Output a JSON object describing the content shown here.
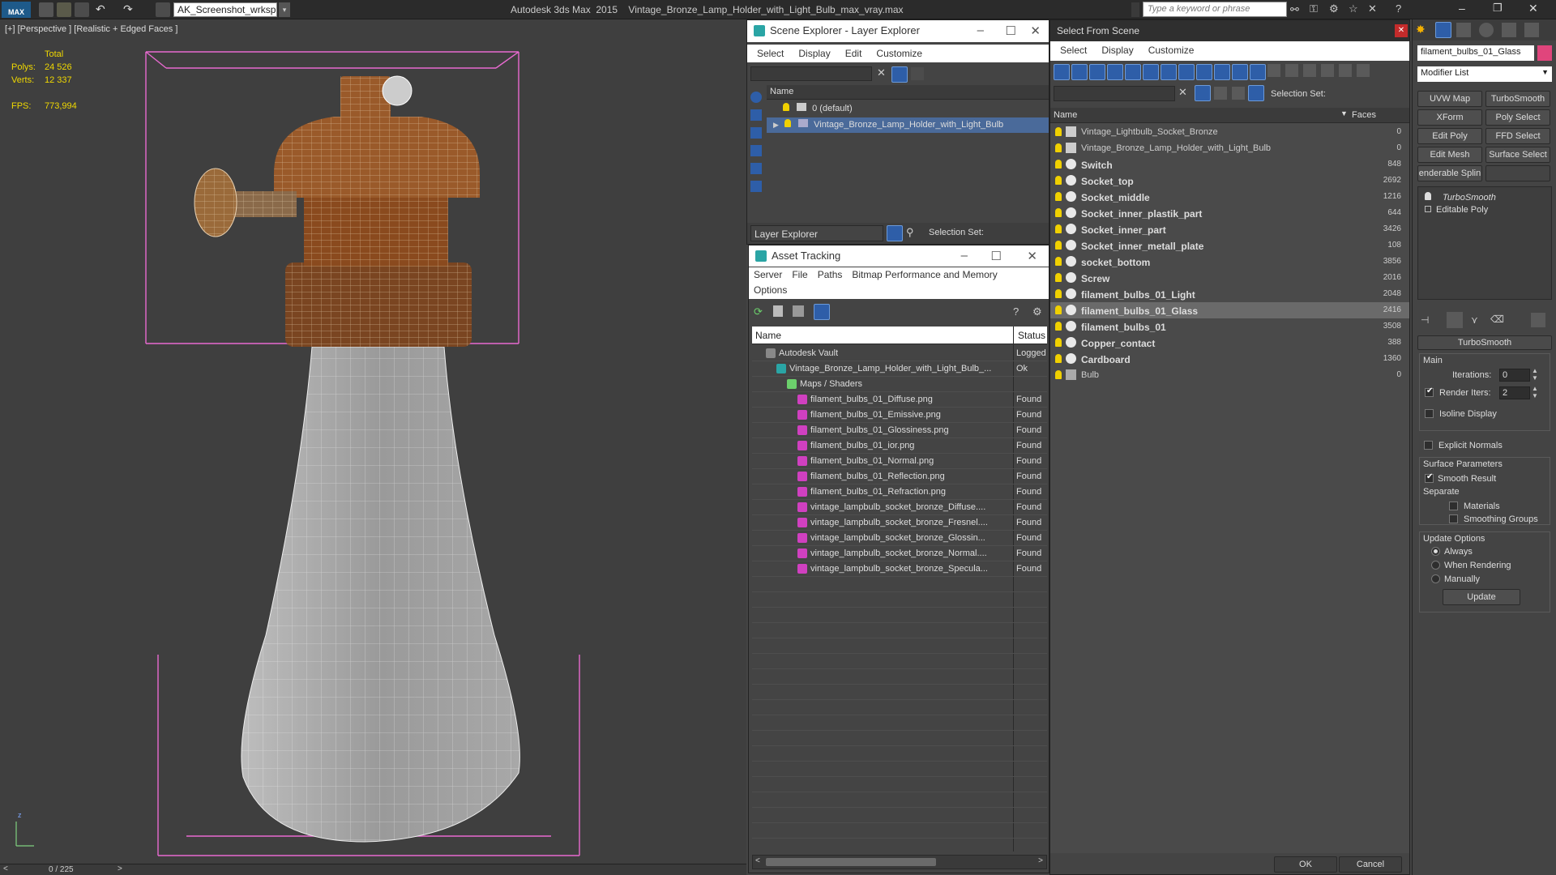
{
  "app": {
    "title": "Autodesk 3ds Max  2015    Vintage_Bronze_Lamp_Holder_with_Light_Bulb_max_vray.max",
    "workspace": "AK_Screenshot_wrksp",
    "search_placeholder": "Type a keyword or phrase",
    "logo": "MAX"
  },
  "viewport": {
    "label": "[+] [Perspective ] [Realistic + Edged Faces ]",
    "stats": {
      "total_label": "Total",
      "polys_label": "Polys:",
      "polys": "24 526",
      "verts_label": "Verts:",
      "verts": "12 337",
      "fps_label": "FPS:",
      "fps": "773,994"
    },
    "timeline": "0 / 225"
  },
  "scene_explorer": {
    "title": "Scene Explorer - Layer Explorer",
    "menu": [
      "Select",
      "Display",
      "Edit",
      "Customize"
    ],
    "col_name": "Name",
    "layers": [
      {
        "name": "0 (default)",
        "selected": false
      },
      {
        "name": "Vintage_Bronze_Lamp_Holder_with_Light_Bulb",
        "selected": true
      }
    ],
    "footer_combo": "Layer Explorer",
    "selection_set": "Selection Set:"
  },
  "asset_tracking": {
    "title": "Asset Tracking",
    "menu1": [
      "Server",
      "File",
      "Paths",
      "Bitmap Performance and Memory"
    ],
    "menu2": [
      "Options"
    ],
    "col_name": "Name",
    "col_status": "Status",
    "rows": [
      {
        "name": "Autodesk Vault",
        "status": "Logged",
        "indent": 1,
        "icon": "vault-icon"
      },
      {
        "name": "Vintage_Bronze_Lamp_Holder_with_Light_Bulb_...",
        "status": "Ok",
        "indent": 2,
        "icon": "max-file-icon"
      },
      {
        "name": "Maps / Shaders",
        "status": "",
        "indent": 3,
        "icon": "maps-icon"
      },
      {
        "name": "filament_bulbs_01_Diffuse.png",
        "status": "Found",
        "indent": 4,
        "icon": "png-icon"
      },
      {
        "name": "filament_bulbs_01_Emissive.png",
        "status": "Found",
        "indent": 4,
        "icon": "png-icon"
      },
      {
        "name": "filament_bulbs_01_Glossiness.png",
        "status": "Found",
        "indent": 4,
        "icon": "png-icon"
      },
      {
        "name": "filament_bulbs_01_ior.png",
        "status": "Found",
        "indent": 4,
        "icon": "png-icon"
      },
      {
        "name": "filament_bulbs_01_Normal.png",
        "status": "Found",
        "indent": 4,
        "icon": "png-icon"
      },
      {
        "name": "filament_bulbs_01_Reflection.png",
        "status": "Found",
        "indent": 4,
        "icon": "png-icon"
      },
      {
        "name": "filament_bulbs_01_Refraction.png",
        "status": "Found",
        "indent": 4,
        "icon": "png-icon"
      },
      {
        "name": "vintage_lampbulb_socket_bronze_Diffuse....",
        "status": "Found",
        "indent": 4,
        "icon": "png-icon"
      },
      {
        "name": "vintage_lampbulb_socket_bronze_Fresnel....",
        "status": "Found",
        "indent": 4,
        "icon": "png-icon"
      },
      {
        "name": "vintage_lampbulb_socket_bronze_Glossin...",
        "status": "Found",
        "indent": 4,
        "icon": "png-icon"
      },
      {
        "name": "vintage_lampbulb_socket_bronze_Normal....",
        "status": "Found",
        "indent": 4,
        "icon": "png-icon"
      },
      {
        "name": "vintage_lampbulb_socket_bronze_Specula...",
        "status": "Found",
        "indent": 4,
        "icon": "png-icon"
      }
    ]
  },
  "select_from_scene": {
    "title": "Select From Scene",
    "menu": [
      "Select",
      "Display",
      "Customize"
    ],
    "selection_set": "Selection Set:",
    "col_name": "Name",
    "col_faces": "Faces",
    "objects": [
      {
        "name": "Vintage_Lightbulb_Socket_Bronze",
        "faces": "0",
        "bold": false,
        "selected": false,
        "kind": "group"
      },
      {
        "name": "Vintage_Bronze_Lamp_Holder_with_Light_Bulb",
        "faces": "0",
        "bold": false,
        "selected": false,
        "kind": "group"
      },
      {
        "name": "Switch",
        "faces": "848",
        "bold": true,
        "selected": false,
        "kind": "mesh"
      },
      {
        "name": "Socket_top",
        "faces": "2692",
        "bold": true,
        "selected": false,
        "kind": "mesh"
      },
      {
        "name": "Socket_middle",
        "faces": "1216",
        "bold": true,
        "selected": false,
        "kind": "mesh"
      },
      {
        "name": "Socket_inner_plastik_part",
        "faces": "644",
        "bold": true,
        "selected": false,
        "kind": "mesh"
      },
      {
        "name": "Socket_inner_part",
        "faces": "3426",
        "bold": true,
        "selected": false,
        "kind": "mesh"
      },
      {
        "name": "Socket_inner_metall_plate",
        "faces": "108",
        "bold": true,
        "selected": false,
        "kind": "mesh"
      },
      {
        "name": "socket_bottom",
        "faces": "3856",
        "bold": true,
        "selected": false,
        "kind": "mesh"
      },
      {
        "name": "Screw",
        "faces": "2016",
        "bold": true,
        "selected": false,
        "kind": "mesh"
      },
      {
        "name": "filament_bulbs_01_Light",
        "faces": "2048",
        "bold": true,
        "selected": false,
        "kind": "mesh"
      },
      {
        "name": "filament_bulbs_01_Glass",
        "faces": "2416",
        "bold": true,
        "selected": true,
        "kind": "mesh"
      },
      {
        "name": "filament_bulbs_01",
        "faces": "3508",
        "bold": true,
        "selected": false,
        "kind": "mesh"
      },
      {
        "name": "Copper_contact",
        "faces": "388",
        "bold": true,
        "selected": false,
        "kind": "mesh"
      },
      {
        "name": "Cardboard",
        "faces": "1360",
        "bold": true,
        "selected": false,
        "kind": "mesh"
      },
      {
        "name": "Bulb",
        "faces": "0",
        "bold": false,
        "selected": false,
        "kind": "light"
      }
    ],
    "ok": "OK",
    "cancel": "Cancel"
  },
  "command_panel": {
    "object_name": "filament_bulbs_01_Glass",
    "modifier_list": "Modifier List",
    "buttons": [
      "UVW Map",
      "TurboSmooth",
      "XForm",
      "Poly Select",
      "Edit Poly",
      "FFD Select",
      "Edit Mesh",
      "Surface Select",
      "enderable Splin",
      ""
    ],
    "stack": [
      "TurboSmooth",
      "Editable Poly"
    ],
    "rollout_title": "TurboSmooth",
    "main_label": "Main",
    "iterations_label": "Iterations:",
    "iterations": "0",
    "render_iters_label": "Render Iters:",
    "render_iters": "2",
    "isoline": "Isoline Display",
    "explicit": "Explicit Normals",
    "surface_params": "Surface Parameters",
    "smooth_result": "Smooth Result",
    "separate": "Separate",
    "materials": "Materials",
    "smoothing_groups": "Smoothing Groups",
    "update_options": "Update Options",
    "always": "Always",
    "when_rendering": "When Rendering",
    "manually": "Manually",
    "update_btn": "Update"
  },
  "colors": {
    "accent": "#4a6a9a",
    "bronze": "#8a4a1e",
    "stats": "#f0d800",
    "selection_box": "#e86ad0"
  }
}
